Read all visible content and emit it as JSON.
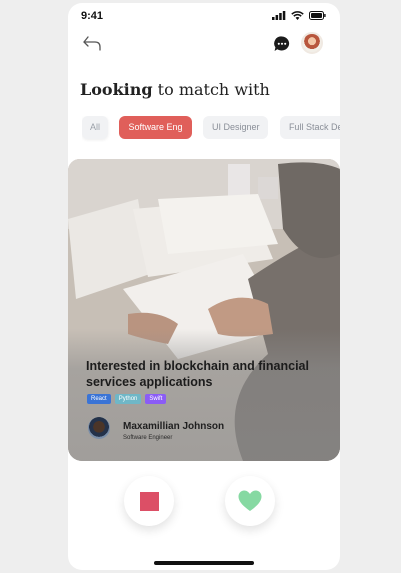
{
  "status_bar": {
    "time": "9:41"
  },
  "heading": {
    "bold": "Looking",
    "rest": "to match with"
  },
  "filters": [
    {
      "label": "All"
    },
    {
      "label": "Software Eng"
    },
    {
      "label": "UI Designer"
    },
    {
      "label": "Full Stack Developer"
    }
  ],
  "active_filter": "Software Eng",
  "card": {
    "title": "Interested in blockchain and financial services applications",
    "tags": [
      {
        "label": "React",
        "color": "#3a74d6"
      },
      {
        "label": "Python",
        "color": "#6fb7c7"
      },
      {
        "label": "Swift",
        "color": "#8b5cf6"
      }
    ],
    "person": {
      "name": "Maxamillian Johnson",
      "role": "Software Engineer"
    }
  },
  "colors": {
    "accent": "#e05f5a",
    "reject": "#dc4f66",
    "like": "#86d9a2"
  },
  "icons": [
    "back-icon",
    "chat-icon",
    "signal-icon",
    "wifi-icon",
    "battery-icon",
    "stop-icon",
    "heart-icon"
  ]
}
